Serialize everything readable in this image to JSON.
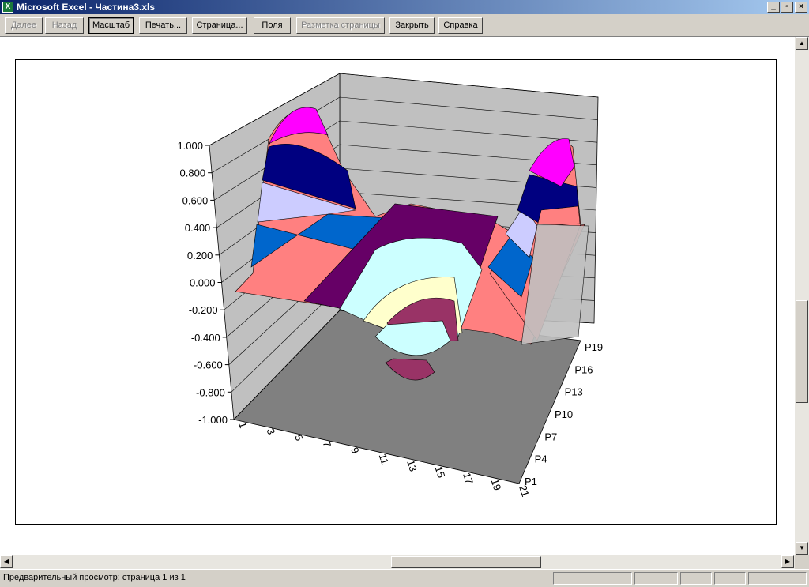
{
  "window": {
    "title": "Microsoft Excel - Частина3.xls",
    "app_icon": "excel-icon",
    "controls": [
      "minimize",
      "maximize",
      "close"
    ]
  },
  "toolbar": {
    "buttons": [
      {
        "label": "Далее",
        "state": "disabled"
      },
      {
        "label": "Назад",
        "state": "disabled"
      },
      {
        "label": "Масштаб",
        "state": "pressed"
      },
      {
        "label": "Печать...",
        "state": "normal"
      },
      {
        "label": "Страница...",
        "state": "normal"
      },
      {
        "label": "Поля",
        "state": "normal"
      },
      {
        "label": "Разметка страницы",
        "state": "disabled"
      },
      {
        "label": "Закрыть",
        "state": "normal"
      },
      {
        "label": "Справка",
        "state": "normal"
      }
    ]
  },
  "status": {
    "text": "Предварительный просмотр: страница 1 из 1"
  },
  "chart_data": {
    "type": "surface",
    "z_ticks": [
      "1.000",
      "0.800",
      "0.600",
      "0.400",
      "0.200",
      "0.000",
      "-0.200",
      "-0.400",
      "-0.600",
      "-0.800",
      "-1.000"
    ],
    "zlim": [
      -1,
      1
    ],
    "x_categories": [
      "1",
      "3",
      "5",
      "7",
      "9",
      "11",
      "13",
      "15",
      "17",
      "19",
      "21"
    ],
    "series_axis": [
      "P1",
      "P4",
      "P7",
      "P10",
      "P13",
      "P16",
      "P19"
    ],
    "band_colors": [
      "#ff00ff",
      "#000080",
      "#ccccff",
      "#0066cc",
      "#ff8080",
      "#660066",
      "#ccffff",
      "#ffffcc",
      "#993366"
    ],
    "wall_color": "#c0c0c0",
    "floor_color": "#808080"
  }
}
